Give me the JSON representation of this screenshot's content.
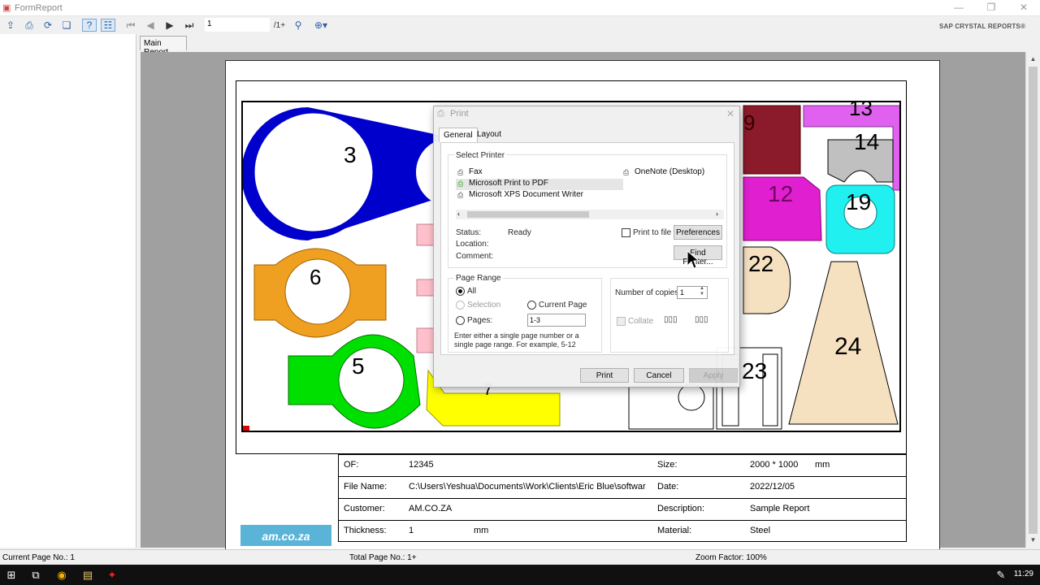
{
  "window": {
    "title": "FormReport",
    "brand": "SAP CRYSTAL REPORTS®"
  },
  "toolbar": {
    "page_value": "1",
    "page_total": "/1+"
  },
  "tabs": {
    "main_report": "Main Report"
  },
  "drawing": {
    "part_labels": [
      "3",
      "6",
      "5",
      "7",
      "9",
      "13",
      "14",
      "12",
      "19",
      "22",
      "23",
      "24"
    ],
    "colors": {
      "blue": "#0000cc",
      "orange": "#f0a020",
      "green": "#00e000",
      "yellow": "#ffff00",
      "maroon": "#8b1a2a",
      "magenta": "#e020d0",
      "violet": "#e060f0",
      "cyan": "#20f0f0",
      "beige": "#f5e0c0",
      "pink": "#ffc0cb",
      "gray": "#c0c0c0"
    }
  },
  "info": {
    "rows": [
      {
        "l1": "OF:",
        "v1": "12345",
        "l2": "Size:",
        "v2": "2000 * 1000",
        "u2": "mm"
      },
      {
        "l1": "File Name:",
        "v1": "C:\\Users\\Yeshua\\Documents\\Work\\Clients\\Eric Blue\\softwar",
        "l2": "Date:",
        "v2": "2022/12/05"
      },
      {
        "l1": "Customer:",
        "v1": "AM.CO.ZA",
        "l2": "Description:",
        "v2": "Sample Report"
      },
      {
        "l1": "Thickness:",
        "v1": "1",
        "u1": "mm",
        "l2": "Material:",
        "v2": "Steel"
      }
    ],
    "logo": "am.co.za"
  },
  "status": {
    "current_page": "Current Page No.: 1",
    "total_page": "Total Page No.: 1+",
    "zoom": "Zoom Factor: 100%"
  },
  "taskbar": {
    "clock": "11:29"
  },
  "print_dialog": {
    "title": "Print",
    "tabs": [
      "General",
      "Layout"
    ],
    "select_printer": "Select Printer",
    "printers": [
      "Fax",
      "Microsoft Print to PDF",
      "Microsoft XPS Document Writer"
    ],
    "printer_right": "OneNote (Desktop)",
    "status_label": "Status:",
    "status_value": "Ready",
    "location_label": "Location:",
    "comment_label": "Comment:",
    "print_to_file": "Print to file",
    "preferences": "Preferences",
    "find_printer": "Find Printer...",
    "page_range": "Page Range",
    "range_all": "All",
    "range_selection": "Selection",
    "range_current": "Current Page",
    "range_pages": "Pages:",
    "pages_value": "1-3",
    "range_hint": "Enter either a single page number or a single page range.  For example, 5-12",
    "copies_label": "Number of copies:",
    "copies_value": "1",
    "collate": "Collate",
    "print_btn": "Print",
    "cancel_btn": "Cancel",
    "apply_btn": "Apply"
  }
}
